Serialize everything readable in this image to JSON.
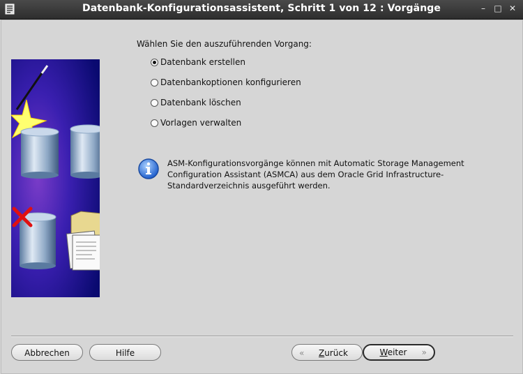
{
  "window": {
    "title": "Datenbank-Konfigurationsassistent, Schritt 1 von 12 : Vorgänge",
    "controls": {
      "minimize": "–",
      "maximize": "□",
      "close": "✕"
    }
  },
  "main": {
    "prompt": "Wählen Sie den auszuführenden Vorgang:",
    "options": [
      {
        "label": "Datenbank erstellen",
        "selected": true
      },
      {
        "label": "Datenbankoptionen konfigurieren",
        "selected": false
      },
      {
        "label": "Datenbank löschen",
        "selected": false
      },
      {
        "label": "Vorlagen verwalten",
        "selected": false
      }
    ],
    "info": "ASM-Konfigurationsvorgänge können mit Automatic Storage Management\nConfiguration Assistant (ASMCA) aus dem Oracle Grid Infrastructure-\nStandardverzeichnis ausgeführt werden."
  },
  "buttons": {
    "cancel": "Abbrechen",
    "help": "Hilfe",
    "back_u": "Z",
    "back_rest": "urück",
    "next_u": "W",
    "next_rest": "eiter"
  },
  "colors": {
    "titlebar": "#333333",
    "background": "#d6d6d6",
    "info_blue": "#2a6fd6",
    "image_bg": "#1a1a9a"
  },
  "icons": [
    "window-menu-icon",
    "info-icon",
    "wizard-database-illustration",
    "chevron-left-icon",
    "chevron-right-icon"
  ]
}
